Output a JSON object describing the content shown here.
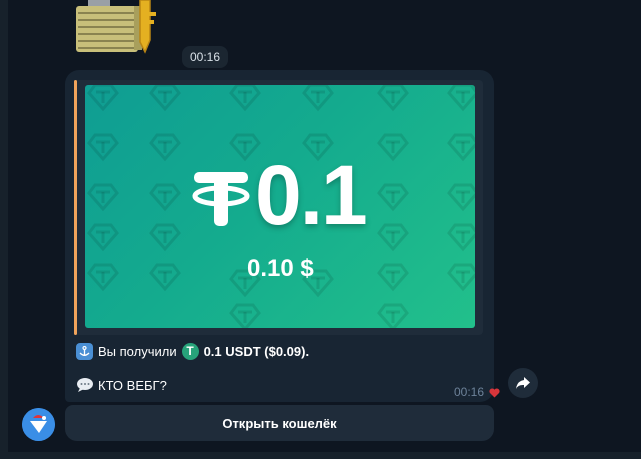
{
  "sticker": {
    "icon": "lock-with-key-icon"
  },
  "sticker_time": "00:16",
  "card": {
    "amount": "0.1",
    "amount_usd": "0.10 $",
    "icon": "tether-icon",
    "gradient_start": "#0f9d93",
    "gradient_end": "#22c08b"
  },
  "message": {
    "received_prefix": "Вы получили",
    "asset_amount": "0.1 USDT ($0.09).",
    "comment": "КТО ВЕБГ?",
    "time": "00:16"
  },
  "wallet_button": {
    "label": "Открыть кошелёк"
  },
  "colors": {
    "background": "#0e1621",
    "bubble": "#182533",
    "accent_border": "#f0a35b",
    "tether_green": "#27a37a"
  }
}
